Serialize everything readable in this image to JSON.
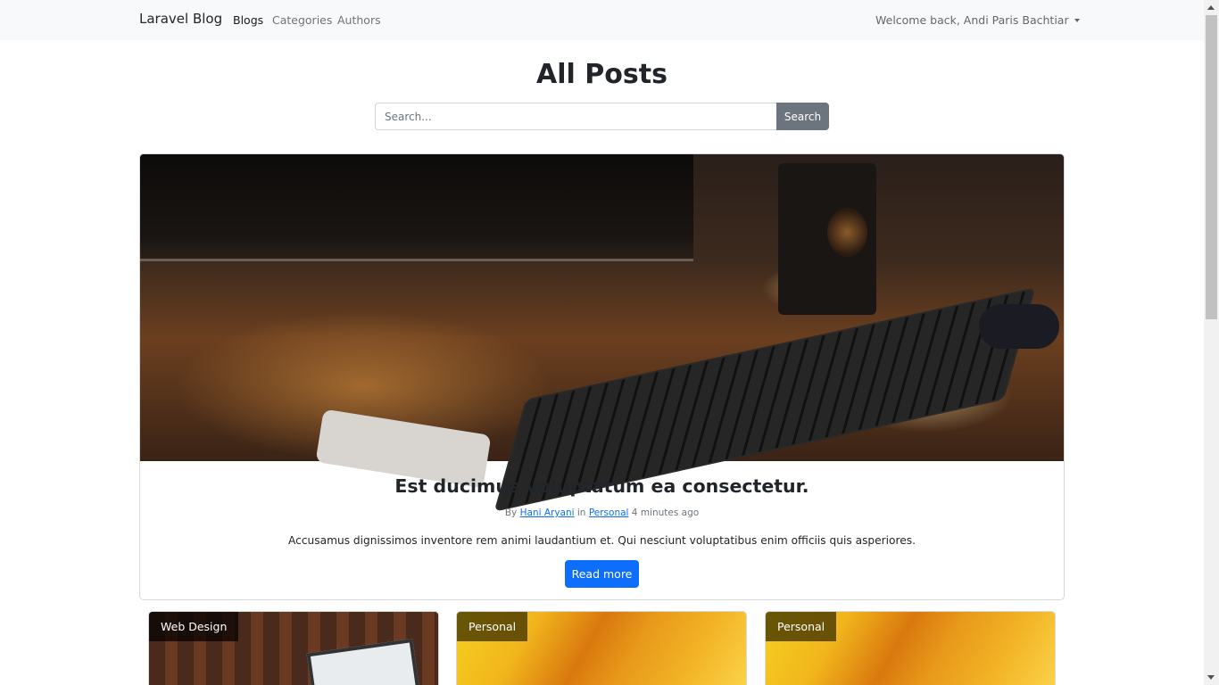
{
  "navbar": {
    "brand": "Laravel Blog",
    "links": [
      {
        "label": "Blogs",
        "active": true
      },
      {
        "label": "Categories",
        "active": false
      },
      {
        "label": "Authors",
        "active": false
      }
    ],
    "user_menu": "Welcome back, Andi Paris Bachtiar"
  },
  "page": {
    "title": "All Posts"
  },
  "search": {
    "placeholder": "Search...",
    "button_label": "Search"
  },
  "featured_post": {
    "title": "Est ducimus voluptatum ea consectetur.",
    "meta_by": "By",
    "author": "Hani Aryani",
    "meta_in": "in",
    "category": "Personal",
    "time_ago": "4 minutes ago",
    "excerpt": "Accusamus dignissimos inventore rem animi laudantium et. Qui nesciunt voluptatibus enim officiis quis asperiores.",
    "read_more_label": "Read more"
  },
  "posts": [
    {
      "category": "Web Design"
    },
    {
      "category": "Personal"
    },
    {
      "category": "Personal"
    }
  ],
  "colors": {
    "primary": "#0d6efd",
    "secondary": "#6c757d",
    "navbar_bg": "#f8f9fa"
  }
}
